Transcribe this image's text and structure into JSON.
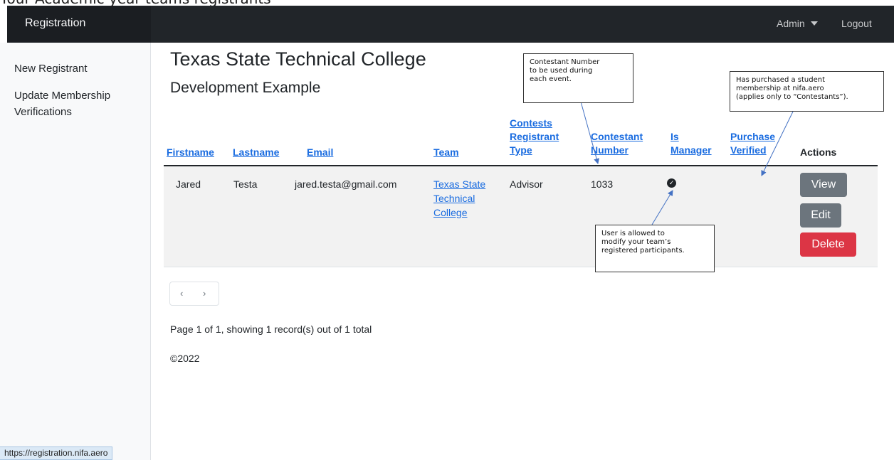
{
  "top_text": "Your Academic year teams registrants",
  "navbar": {
    "brand": "Registration",
    "admin": "Admin",
    "logout": "Logout"
  },
  "sidebar": {
    "new_registrant": "New Registrant",
    "update_membership": "Update Membership Verifications"
  },
  "status_url": "https://registration.nifa.aero",
  "page": {
    "title": "Texas State Technical College",
    "subtitle": "Development Example"
  },
  "table": {
    "headers": {
      "firstname": "Firstname",
      "lastname": "Lastname",
      "email": "Email",
      "team": "Team",
      "type_line1": "Contests",
      "type_line2": "Registrant",
      "type_line3": "Type",
      "number_line1": "Contestant",
      "number_line2": "Number",
      "manager_line1": "Is",
      "manager_line2": "Manager",
      "verified_line1": "Purchase",
      "verified_line2": "Verified",
      "actions": "Actions"
    },
    "rows": [
      {
        "firstname": "Jared",
        "lastname": "Testa",
        "email": "jared.testa@gmail.com",
        "team_line1": "Texas State",
        "team_line2": "Technical",
        "team_line3": "College",
        "type": "Advisor",
        "number": "1033",
        "is_manager": true
      }
    ]
  },
  "actions": {
    "view": "View",
    "edit": "Edit",
    "delete": "Delete"
  },
  "pagination": {
    "prev": "‹",
    "next": "›",
    "info": "Page 1 of 1, showing 1 record(s) out of 1 total"
  },
  "footer": "©2022",
  "annotations": {
    "contestant_number": [
      "Contestant Number",
      "to be used during",
      "each event."
    ],
    "purchase": [
      "Has purchased a student",
      "membership at nifa.aero",
      "(applies only to “Contestants”)."
    ],
    "manager": [
      "User is allowed to",
      "modify your team’s",
      "registered participants."
    ]
  },
  "colors": {
    "navbar": "#212529",
    "link": "#1a6ce0",
    "btn_grey": "#6c757d",
    "btn_red": "#dc3545",
    "row": "#f2f2f2",
    "arrow": "#4472c4"
  }
}
